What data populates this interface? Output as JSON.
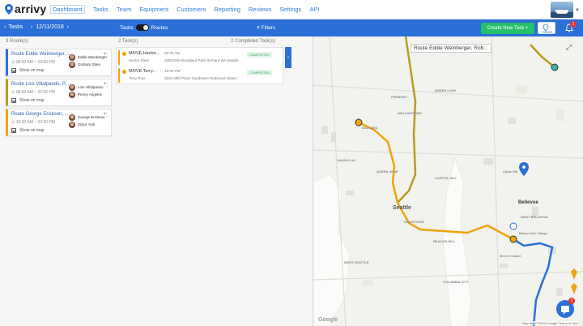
{
  "app": {
    "logo_text": "arrivy"
  },
  "nav": {
    "items": [
      "Dashboard",
      "Tasks",
      "Team",
      "Equipment",
      "Customers",
      "Reporting",
      "Reviews",
      "Settings",
      "API"
    ],
    "active": "Dashboard"
  },
  "toolbar": {
    "tasks_label": "Tasks",
    "date": "12/11/2018",
    "toggle_left": "Tasks",
    "toggle_right": "Routes",
    "filters_label": "Filters",
    "create_label": "Create New Task +",
    "notifications_count": "1"
  },
  "columns": {
    "routes_header": "3 Route(s)",
    "tasks_header": "2 Task(s)",
    "completed_header": "2 Completed Task(s)"
  },
  "routes": [
    {
      "title": "Route Eddie Weinberger, ...",
      "time": "08:00 AM – 03:00 PM",
      "show_map": "Show on map",
      "people": [
        "Eddie Weinberger",
        "Graham Giles"
      ],
      "color": "#2b6fd9"
    },
    {
      "title": "Route Lois Villalpando, P...",
      "time": "08:00 AM – 02:00 PM",
      "show_map": "Show on map",
      "people": [
        "Lois Villalpando",
        "Penny Angeles"
      ],
      "color": "#b79d1e"
    },
    {
      "title": "Route George Erickson, ...",
      "time": "10:00 AM – 02:30 PM",
      "show_map": "Show on map",
      "people": [
        "George Erickson",
        "Victor York"
      ],
      "color": "#f0a30a"
    }
  ],
  "tasks": [
    {
      "name": "MOVE Hector...",
      "person": "Hector Shen",
      "time": "09:00 AM",
      "addr": "3393 NW Woodland Park Orchard WA Seattle",
      "status": "COMPLETED"
    },
    {
      "name": "MOVE Terry...",
      "person": "Terry Ruiz",
      "time": "12:00 PM",
      "addr": "3232 50th Place Southwest Redmond Island",
      "status": "COMPLETED"
    }
  ],
  "map": {
    "route_label": "Route Eddie Weinberger, Rob...",
    "cities": {
      "seattle": "Seattle",
      "bellevue": "Bellevue",
      "clyde_hill": "Clyde Hill",
      "west_bellevue": "WEST BELLEVUE",
      "mercer_island": "Mercer Island",
      "beaux_arts": "Beaux Arts Village",
      "downtown": "DOWNTOWN",
      "ballard": "BALLARD",
      "fremont": "FREMONT",
      "green_lake": "GREEN LAKE",
      "wallingford": "WALLINGFORD",
      "beacon_hill": "BEACON HILL",
      "columbia_city": "COLUMBIA CITY",
      "west_seattle": "WEST SEATTLE",
      "magnolia": "MAGNOLIA",
      "capitol_hill": "CAPITOL HILL",
      "queen_anne": "QUEEN ANNE"
    },
    "google": "Google",
    "footer": "Map data ©2018 Google   Terms of Use",
    "chat_badge": "1",
    "route_colors": {
      "blue": "#2b6fd9",
      "olive": "#b79d1e",
      "orange": "#f0a30a"
    }
  }
}
